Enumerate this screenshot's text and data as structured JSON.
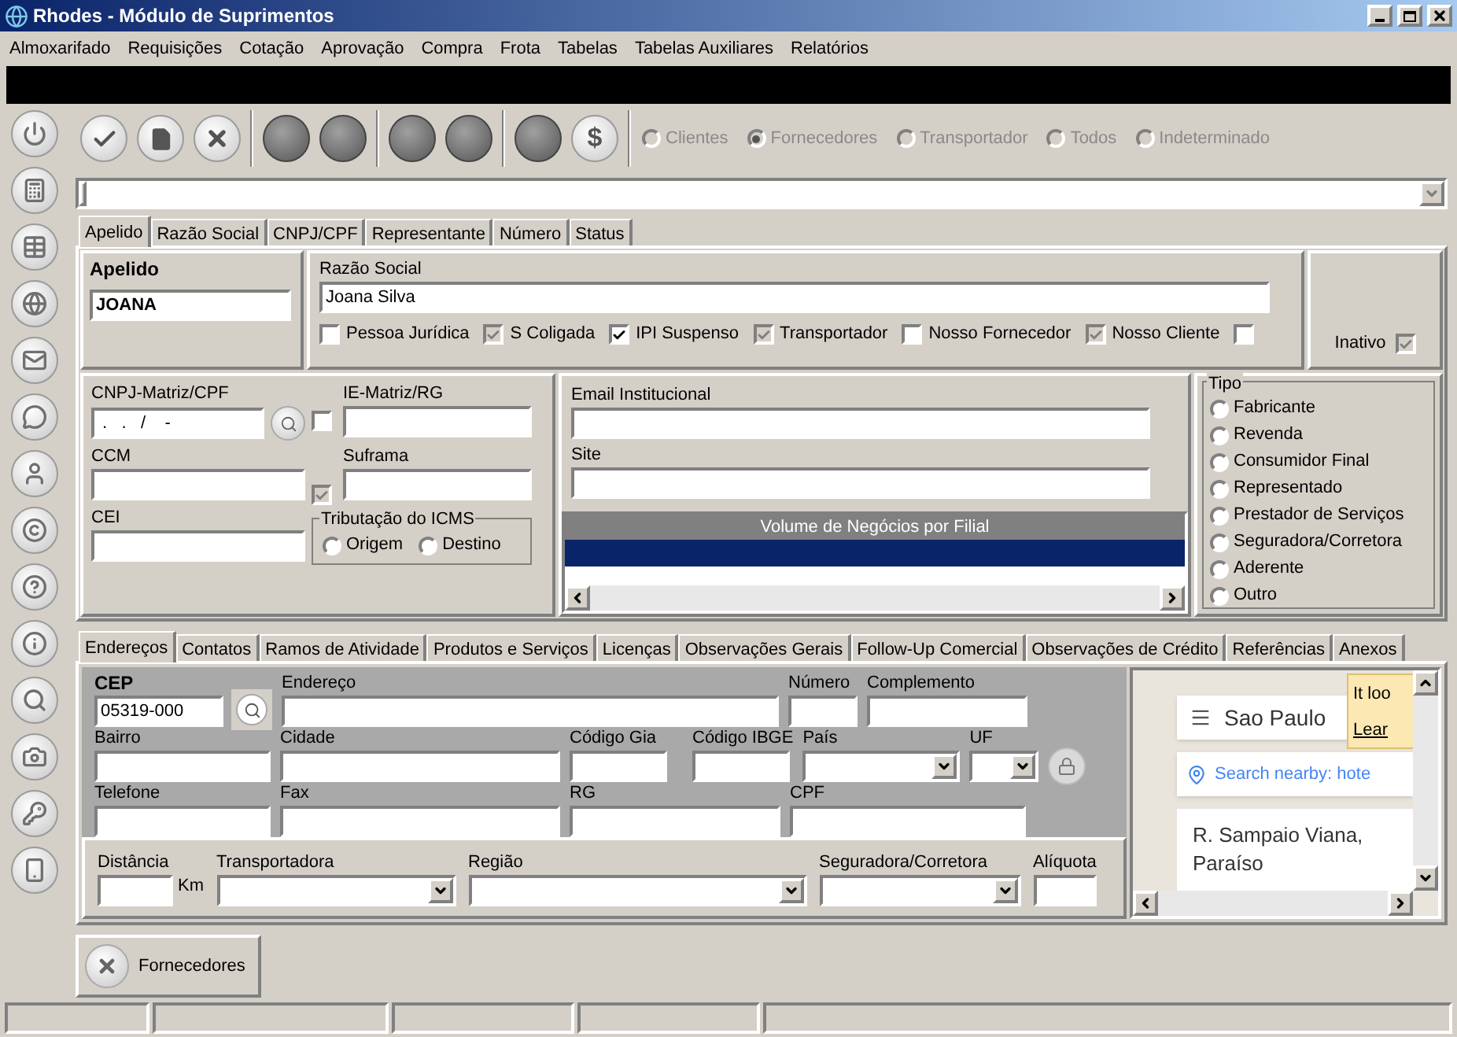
{
  "window": {
    "title": "Rhodes - Módulo de Suprimentos"
  },
  "menu": [
    "Almoxarifado",
    "Requisições",
    "Cotação",
    "Aprovação",
    "Compra",
    "Frota",
    "Tabelas",
    "Tabelas Auxiliares",
    "Relatórios"
  ],
  "toolbar": {
    "buttons": [
      {
        "kind": "confirm"
      },
      {
        "kind": "page"
      },
      {
        "kind": "cancel"
      },
      {
        "kind": "separator"
      },
      {
        "kind": "blank"
      },
      {
        "kind": "blank"
      },
      {
        "kind": "separator"
      },
      {
        "kind": "blank"
      },
      {
        "kind": "blank"
      },
      {
        "kind": "separator"
      },
      {
        "kind": "blank"
      },
      {
        "kind": "text",
        "label": "$"
      },
      {
        "kind": "separator"
      }
    ],
    "filter_options": [
      {
        "label": "Clientes",
        "selected": false
      },
      {
        "label": "Fornecedores",
        "selected": true
      },
      {
        "label": "Transportador",
        "selected": false
      },
      {
        "label": "Todos",
        "selected": false
      },
      {
        "label": "Indeterminado",
        "selected": false
      }
    ]
  },
  "search_tabs": [
    {
      "label": "Apelido",
      "selected": true
    },
    {
      "label": "Razão Social",
      "selected": false
    },
    {
      "label": "CNPJ/CPF",
      "selected": false
    },
    {
      "label": "Representante",
      "selected": false
    },
    {
      "label": "Número",
      "selected": false
    },
    {
      "label": "Status",
      "selected": false
    }
  ],
  "apelido": {
    "label": "Apelido",
    "value": "JOANA"
  },
  "razao_social": {
    "label": "Razão Social",
    "value": "Joana Silva"
  },
  "flags": [
    {
      "label": "Pessoa Jurídica",
      "checked": false
    },
    {
      "label": "S Coligada",
      "checked": true
    },
    {
      "label": "IPI Suspenso",
      "checked": true
    },
    {
      "label": "Transportador",
      "checked": true
    },
    {
      "label": "Nosso Fornecedor",
      "checked": false
    },
    {
      "label": "Nosso Cliente",
      "checked": true
    },
    {
      "checked": false
    }
  ],
  "inativo": {
    "label": "Inativo",
    "checked": true
  },
  "cnpj": {
    "label": "CNPJ-Matriz/CPF",
    "value": " .   .   /    -"
  },
  "ie_checkbox": {
    "checked": false
  },
  "ie": {
    "label": "IE-Matriz/RG"
  },
  "ccm": {
    "label": "CCM"
  },
  "suframa_checkbox": {
    "checked": true
  },
  "suframa": {
    "label": "Suframa"
  },
  "cei": {
    "label": "CEI"
  },
  "icms": {
    "title": "Tributação do ICMS",
    "options": [
      {
        "label": "Origem",
        "selected": false
      },
      {
        "label": "Destino",
        "selected": false
      }
    ]
  },
  "email": {
    "label": "Email Institucional"
  },
  "site": {
    "label": "Site"
  },
  "volume_grid": {
    "title": "Volume de Negócios por Filial"
  },
  "tipo": {
    "title": "Tipo",
    "options": [
      {
        "label": "Fabricante",
        "selected": false
      },
      {
        "label": "Revenda",
        "selected": false
      },
      {
        "label": "Consumidor Final",
        "selected": false
      },
      {
        "label": "Representado",
        "selected": false
      },
      {
        "label": "Prestador de Serviços",
        "selected": false
      },
      {
        "label": "Seguradora/Corretora",
        "selected": false
      },
      {
        "label": "Aderente",
        "selected": false
      },
      {
        "label": "Outro",
        "selected": false
      }
    ]
  },
  "detail_tabs": [
    {
      "label": "Endereços",
      "selected": true
    },
    {
      "label": "Contatos",
      "selected": false
    },
    {
      "label": "Ramos de Atividade",
      "selected": false
    },
    {
      "label": "Produtos e Serviços",
      "selected": false
    },
    {
      "label": "Licenças",
      "selected": false
    },
    {
      "label": "Observações Gerais",
      "selected": false
    },
    {
      "label": "Follow-Up Comercial",
      "selected": false
    },
    {
      "label": "Observações de Crédito",
      "selected": false
    },
    {
      "label": "Referências",
      "selected": false
    },
    {
      "label": "Anexos",
      "selected": false
    }
  ],
  "address": {
    "cep": {
      "label": "CEP",
      "value": "05319-000"
    },
    "endereco": {
      "label": "Endereço"
    },
    "numero": {
      "label": "Número"
    },
    "complemento": {
      "label": "Complemento"
    },
    "bairro": {
      "label": "Bairro"
    },
    "cidade": {
      "label": "Cidade"
    },
    "codigo_gia": {
      "label": "Código Gia"
    },
    "codigo_ibge": {
      "label": "Código IBGE"
    },
    "pais": {
      "label": "País"
    },
    "uf": {
      "label": "UF"
    },
    "telefone": {
      "label": "Telefone"
    },
    "fax": {
      "label": "Fax"
    },
    "rg": {
      "label": "RG"
    },
    "cpf": {
      "label": "CPF"
    }
  },
  "logistics": {
    "distancia": {
      "label": "Distância",
      "unit": "Km"
    },
    "transportadora": {
      "label": "Transportadora"
    },
    "regiao": {
      "label": "Região"
    },
    "seguradora": {
      "label": "Seguradora/Corretora"
    },
    "aliquota": {
      "label": "Alíquota"
    }
  },
  "map": {
    "place": "Sao Paulo",
    "search": "Search nearby: hote",
    "address_line": "R. Sampaio Viana,",
    "district": "Paraíso",
    "notice": "It loo",
    "notice_link": "Lear"
  },
  "open_windows": [
    {
      "label": "Fornecedores"
    }
  ]
}
